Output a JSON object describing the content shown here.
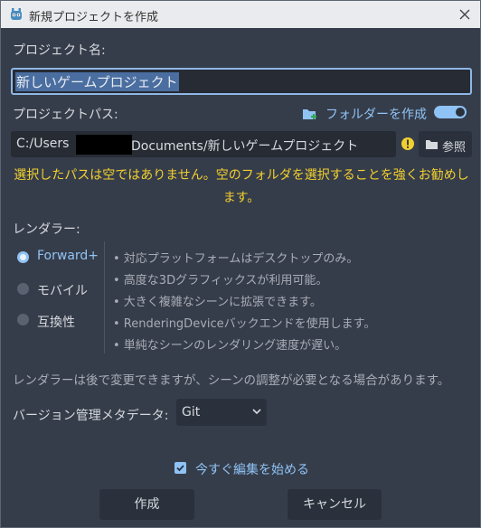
{
  "window": {
    "title": "新規プロジェクトを作成"
  },
  "project_name": {
    "label": "プロジェクト名:",
    "value": "新しいゲームプロジェクト"
  },
  "project_path": {
    "label": "プロジェクトパス:",
    "create_folder_label": "フォルダーを作成",
    "create_folder_enabled": true,
    "value_prefix": "C:/Users",
    "value_suffix": "Documents/新しいゲームプロジェクト",
    "browse_label": "参照"
  },
  "warning": {
    "text": "選択したパスは空ではありません。空のフォルダを選択することを強くお勧めします。",
    "color": "#f2d02f"
  },
  "renderer": {
    "label": "レンダラー:",
    "options": [
      "Forward+",
      "モバイル",
      "互換性"
    ],
    "selected": "Forward+",
    "features": [
      "• 対応プラットフォームはデスクトップのみ。",
      "• 高度な3Dグラフィックスが利用可能。",
      "• 大きく複雑なシーンに拡張できます。",
      "• RenderingDeviceバックエンドを使用します。",
      "• 単純なシーンのレンダリング速度が遅い。"
    ],
    "note": "レンダラーは後で変更できますが、シーンの調整が必要となる場合があります。"
  },
  "vcs": {
    "label": "バージョン管理メタデータ:",
    "value": "Git"
  },
  "edit_now": {
    "label": "今すぐ編集を始める",
    "checked": true
  },
  "buttons": {
    "create": "作成",
    "cancel": "キャンセル"
  },
  "colors": {
    "accent": "#8fc3f5",
    "background": "#363d4a",
    "warning": "#f2d02f"
  }
}
